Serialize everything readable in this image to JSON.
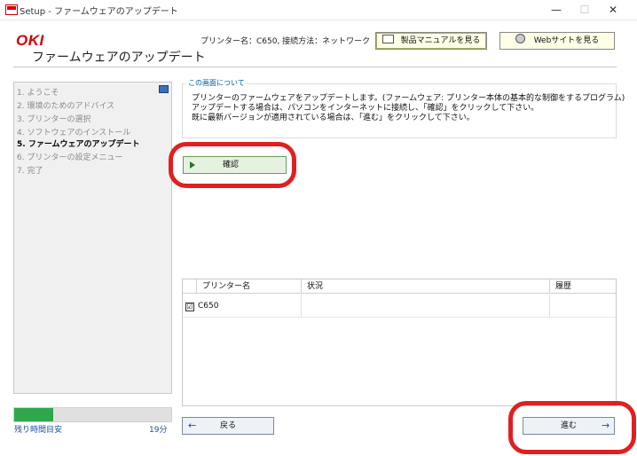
{
  "window": {
    "title": "Setup - ファームウェアのアップデート",
    "minimize": "—",
    "maximize": "☐",
    "close": "✕"
  },
  "header": {
    "logo": "OKI",
    "page_title": "ファームウェアのアップデート",
    "printer_info": "プリンター名：C650, 接続方法：ネットワーク",
    "manual_button": "製品マニュアルを見る",
    "website_button": "Webサイトを見る"
  },
  "sidebar": {
    "steps": [
      {
        "label": "1. ようこそ",
        "active": false
      },
      {
        "label": "2. 環境のためのアドバイス",
        "active": false
      },
      {
        "label": "3. プリンターの選択",
        "active": false
      },
      {
        "label": "4. ソフトウェアのインストール",
        "active": false
      },
      {
        "label": "5. ファームウェアのアップデート",
        "active": true
      },
      {
        "label": "6. プリンターの設定メニュー",
        "active": false
      },
      {
        "label": "7. 完了",
        "active": false
      }
    ],
    "progress_fraction": 0.25,
    "remaining_label": "残り時間目安",
    "remaining_value": "19分"
  },
  "about": {
    "legend": "この画面について",
    "lines": [
      "プリンターのファームウェアをアップデートします。(ファームウェア: プリンター本体の基本的な制御をするプログラム)",
      "アップデートする場合は、パソコンをインターネットに接続し、「確認」をクリックして下さい。",
      "既に最新バージョンが適用されている場合は、「進む」をクリックして下さい。"
    ]
  },
  "confirm_button": "確認",
  "table": {
    "columns": [
      "プリンター名",
      "状況",
      "履歴"
    ],
    "rows": [
      {
        "checked": true,
        "check_glyph": "☑",
        "name": "C650",
        "status": "",
        "history": ""
      }
    ]
  },
  "nav": {
    "back_label": "戻る",
    "back_arrow": "←",
    "next_label": "進む",
    "next_arrow": "→"
  },
  "colors": {
    "brand_red": "#d40000",
    "annotation_red": "#e02020",
    "progress_green": "#2ea84a",
    "link_blue": "#1a4fa0"
  }
}
